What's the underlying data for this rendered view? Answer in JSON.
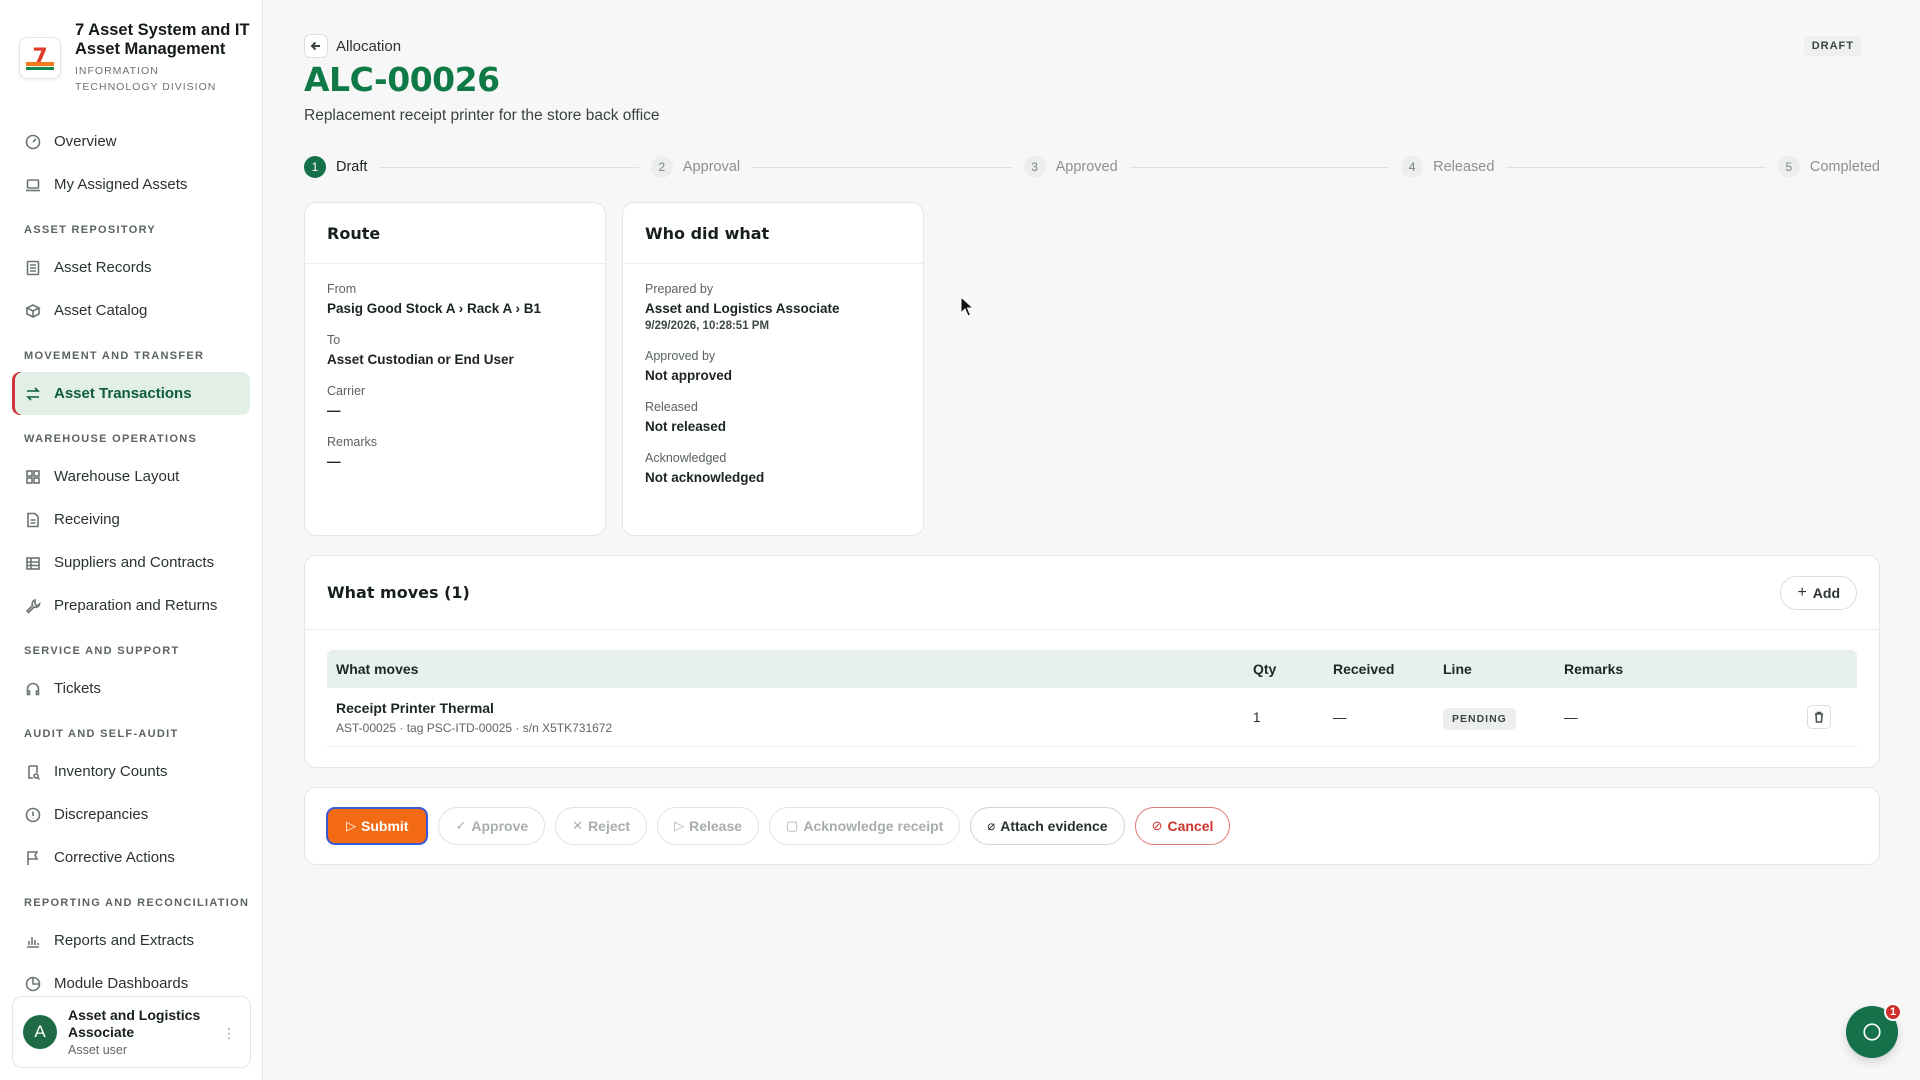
{
  "brand": {
    "title": "7 Asset System and IT Asset Management",
    "subtitle": "INFORMATION TECHNOLOGY DIVISION",
    "logo_text": "7"
  },
  "sidebar": {
    "items": [
      {
        "label": "Overview",
        "icon": "gauge-icon"
      },
      {
        "label": "My Assigned Assets",
        "icon": "laptop-icon"
      }
    ],
    "section_repository": "ASSET REPOSITORY",
    "repository_items": [
      {
        "label": "Asset Records",
        "icon": "list-icon"
      },
      {
        "label": "Asset Catalog",
        "icon": "boxes-icon"
      }
    ],
    "section_movement": "MOVEMENT AND TRANSFER",
    "movement_items": [
      {
        "label": "Asset Transactions",
        "icon": "transfer-icon",
        "active": true
      }
    ],
    "section_warehouse": "WAREHOUSE OPERATIONS",
    "warehouse_items": [
      {
        "label": "Warehouse Layout",
        "icon": "grid-icon"
      },
      {
        "label": "Receiving",
        "icon": "document-icon"
      },
      {
        "label": "Suppliers and Contracts",
        "icon": "building-icon"
      },
      {
        "label": "Preparation and Returns",
        "icon": "wrench-icon"
      }
    ],
    "section_service": "SERVICE AND SUPPORT",
    "service_items": [
      {
        "label": "Tickets",
        "icon": "headset-icon"
      }
    ],
    "section_audit": "AUDIT AND SELF-AUDIT",
    "audit_items": [
      {
        "label": "Inventory Counts",
        "icon": "clipboard-search-icon"
      },
      {
        "label": "Discrepancies",
        "icon": "alert-circle-icon"
      },
      {
        "label": "Corrective Actions",
        "icon": "flag-icon"
      }
    ],
    "section_reporting": "REPORTING AND RECONCILIATION",
    "reporting_items": [
      {
        "label": "Reports and Extracts",
        "icon": "bar-chart-icon"
      },
      {
        "label": "Module Dashboards",
        "icon": "pie-chart-icon"
      }
    ]
  },
  "user": {
    "initial": "A",
    "name": "Asset and Logistics Associate",
    "role": "Asset user"
  },
  "header": {
    "breadcrumb": "Allocation",
    "status": "DRAFT",
    "title": "ALC-00026",
    "description": "Replacement receipt printer for the store back office"
  },
  "stepper": [
    {
      "num": "1",
      "label": "Draft"
    },
    {
      "num": "2",
      "label": "Approval"
    },
    {
      "num": "3",
      "label": "Approved"
    },
    {
      "num": "4",
      "label": "Released"
    },
    {
      "num": "5",
      "label": "Completed"
    }
  ],
  "route": {
    "title": "Route",
    "from_label": "From",
    "from_value": "Pasig Good Stock A › Rack A › B1",
    "to_label": "To",
    "to_value": "Asset Custodian or End User",
    "carrier_label": "Carrier",
    "carrier_value": "—",
    "remarks_label": "Remarks",
    "remarks_value": "—"
  },
  "who": {
    "title": "Who did what",
    "prepared_label": "Prepared by",
    "prepared_value": "Asset and Logistics Associate",
    "prepared_time": "9/29/2026, 10:28:51 PM",
    "approved_label": "Approved by",
    "approved_value": "Not approved",
    "released_label": "Released",
    "released_value": "Not released",
    "ack_label": "Acknowledged",
    "ack_value": "Not acknowledged"
  },
  "moves": {
    "title": "What moves (1)",
    "add_label": "Add",
    "columns": [
      "What moves",
      "Qty",
      "Received",
      "Line",
      "Remarks"
    ],
    "rows": [
      {
        "name": "Receipt Printer Thermal",
        "meta": "AST-00025 · tag PSC-ITD-00025 · s/n X5TK731672",
        "qty": "1",
        "received": "—",
        "line": "PENDING",
        "remarks": "—"
      }
    ]
  },
  "actions": {
    "submit": "Submit",
    "approve": "Approve",
    "reject": "Reject",
    "release": "Release",
    "acknowledge": "Acknowledge receipt",
    "attach": "Attach evidence",
    "cancel": "Cancel"
  },
  "chat": {
    "badge": "1"
  },
  "colors": {
    "brand_green": "#0f7a45",
    "active_bg": "#e2efe7",
    "submit_orange": "#f26a13",
    "danger_red": "#d0342e"
  }
}
